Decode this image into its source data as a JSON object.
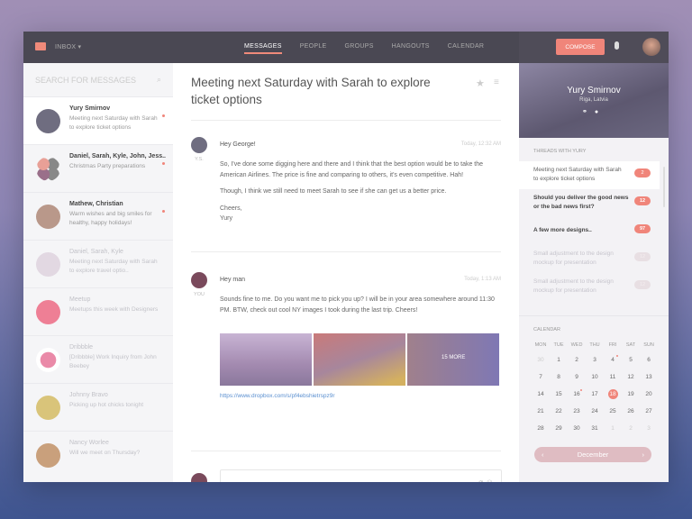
{
  "topbar": {
    "inbox": "INBOX",
    "nav": [
      "MESSAGES",
      "PEOPLE",
      "GROUPS",
      "HANGOUTS",
      "CALENDAR"
    ],
    "compose": "COMPOSE"
  },
  "sidebar": {
    "search_placeholder": "SEARCH FOR MESSAGES",
    "items": [
      {
        "name": "Yury Smirnov",
        "preview": "Meeting next Saturday with Sarah to explore ticket options",
        "unread": true
      },
      {
        "name": "Daniel, Sarah, Kyle, John, Jess..",
        "preview": "Christmas Party preparations",
        "unread": true,
        "extra_count": "2"
      },
      {
        "name": "Mathew, Christian",
        "preview": "Warm wishes and big smiles for healthy, happy holidays!",
        "unread": true
      },
      {
        "name": "Daniel, Sarah, Kyle",
        "preview": "Meeting next Saturday with Sarah to explore travel optio..",
        "unread": false
      },
      {
        "name": "Meetup",
        "preview": "Meetups this week with Designers",
        "unread": false
      },
      {
        "name": "Dribbble",
        "preview": "[Dribbble] Work Inquiry from John Beebey",
        "unread": false
      },
      {
        "name": "Johnny Bravo",
        "preview": "Picking up hot chicks tonight",
        "unread": false
      },
      {
        "name": "Nancy Worlee",
        "preview": "Will we meet on Thursday?",
        "unread": false
      }
    ]
  },
  "thread": {
    "title": "Meeting next Saturday with Sarah to explore ticket options",
    "messages": [
      {
        "initials": "Y.S.",
        "greeting": "Hey George!",
        "time": "Today, 12:32 AM",
        "paragraphs": [
          "So, I've done some digging here and there and I think that the best option would be to take the American Airlines. The price is fine and comparing to others, it's even competitive. Hah!",
          "Though, I think we still need to meet Sarah to see if she can get us a better price."
        ],
        "signoff": "Cheers,",
        "signature": "Yury"
      },
      {
        "initials": "YOU",
        "greeting": "Hey man",
        "time": "Today, 1:13 AM",
        "paragraphs": [
          "Sounds fine to me. Do you want me to pick you up? I will be in your area somewhere around 11:30 PM. BTW, check out cool NY images I took during the last trip. Cheers!"
        ],
        "more_images": "15 MORE",
        "link": "https://www.dropbox.com/s/pf4ebshietrspz9r"
      }
    ]
  },
  "profile": {
    "name": "Yury Smirnov",
    "location": "Riga, Latvia"
  },
  "threads": {
    "label": "THREADS WITH YURY",
    "items": [
      {
        "title": "Meeting next Saturday with Sarah to explore ticket options",
        "count": "2"
      },
      {
        "title": "Should you deliver the good news or the bad news first?",
        "count": "12"
      },
      {
        "title": "A few more designs..",
        "count": "97"
      },
      {
        "title": "Small adjustment to the design mockup for presentation",
        "count": "12"
      },
      {
        "title": "Small adjustment to the design mockup for presentation",
        "count": "12"
      }
    ]
  },
  "calendar": {
    "label": "CALENDAR",
    "days": [
      "MON",
      "TUE",
      "WED",
      "THU",
      "FRI",
      "SAT",
      "SUN"
    ],
    "dates": [
      "30",
      "1",
      "2",
      "3",
      "4",
      "5",
      "6",
      "7",
      "8",
      "9",
      "10",
      "11",
      "12",
      "13",
      "14",
      "15",
      "16",
      "17",
      "18",
      "19",
      "20",
      "21",
      "22",
      "23",
      "24",
      "25",
      "26",
      "27",
      "28",
      "29",
      "30",
      "31",
      "1",
      "2",
      "3"
    ],
    "selected": "18",
    "event_days": [
      "4",
      "16"
    ],
    "month": "December"
  },
  "colors": {
    "accent": "#f0857a",
    "topbar": "#4a4853",
    "link": "#5a8fd0"
  }
}
